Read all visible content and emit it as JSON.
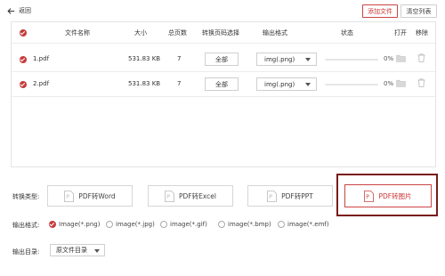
{
  "header": {
    "back_label": "返回",
    "add_file_label": "添加文件",
    "clear_list_label": "清空列表"
  },
  "table": {
    "columns": [
      "文件名称",
      "大小",
      "总页数",
      "转换页码选择",
      "输出格式",
      "状态",
      "打开",
      "移除"
    ],
    "rows": [
      {
        "name": "1.pdf",
        "size": "531.83 KB",
        "pages": "7",
        "page_select": "全部",
        "format": "img(.png)",
        "progress": 0,
        "status": "0%"
      },
      {
        "name": "2.pdf",
        "size": "531.83 KB",
        "pages": "7",
        "page_select": "全部",
        "format": "img(.png)",
        "progress": 0,
        "status": "0%"
      }
    ]
  },
  "conversion": {
    "label": "转换类型:",
    "types": [
      "PDF转Word",
      "PDF转Excel",
      "PDF转PPT",
      "PDF转图片"
    ],
    "selected": "PDF转图片"
  },
  "output_format": {
    "label": "输出格式:",
    "options": [
      "Image(*.png)",
      "image(*.jpg)",
      "image(*.gif)",
      "image(*.bmp)",
      "image(*.emf)"
    ],
    "selected": "Image(*.png)"
  },
  "output_dir": {
    "label": "输出目录:",
    "value": "原文件目录"
  },
  "colors": {
    "accent": "#c63a3a",
    "selected_border": "#7a1a1a"
  }
}
